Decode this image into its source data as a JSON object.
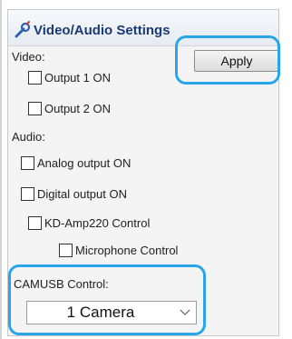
{
  "panel": {
    "title": "Video/Audio Settings",
    "apply_label": "Apply"
  },
  "video": {
    "label": "Video:",
    "options": [
      {
        "label": "Output 1 ON",
        "checked": false
      },
      {
        "label": "Output 2 ON",
        "checked": false
      }
    ]
  },
  "audio": {
    "label": "Audio:",
    "options": [
      {
        "label": "Analog output ON",
        "checked": false
      },
      {
        "label": "Digital output ON",
        "checked": false
      },
      {
        "label": "KD-Amp220 Control",
        "checked": false
      },
      {
        "label": "Microphone Control",
        "checked": false
      }
    ]
  },
  "camusb": {
    "label": "CAMUSB Control:",
    "selected": "1 Camera"
  },
  "colors": {
    "highlight": "#2aa5e8",
    "title_text": "#1c3a73"
  },
  "icons": [
    "settings-wrench-icon",
    "chevron-down-icon"
  ]
}
